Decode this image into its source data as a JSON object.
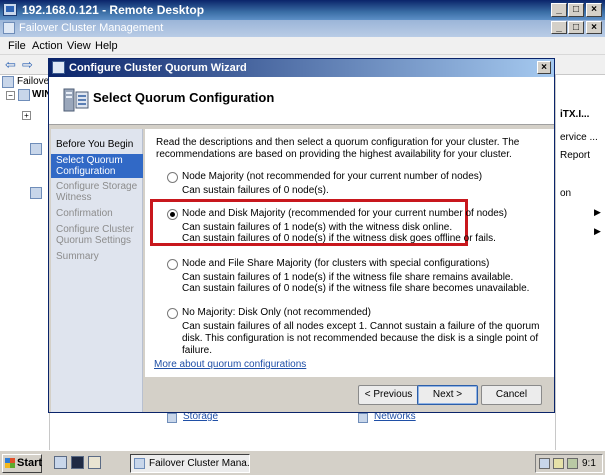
{
  "rdp": {
    "title": "192.168.0.121 - Remote Desktop"
  },
  "server": {
    "title": "Failover Cluster Management",
    "menu": [
      "File",
      "Action",
      "View",
      "Help"
    ],
    "tree": [
      "Failover",
      "WIN"
    ],
    "actions": [
      "iTX.I...",
      "ervice ...",
      "Report",
      "on"
    ],
    "bottom_links": [
      "Storage",
      "Networks"
    ]
  },
  "wizard": {
    "title": "Configure Cluster Quorum Wizard",
    "header_title": "Select Quorum Configuration",
    "close_label": "×",
    "nav": [
      {
        "label": "Before You Begin",
        "state": "done"
      },
      {
        "label": "Select Quorum Configuration",
        "state": "active"
      },
      {
        "label": "Configure Storage Witness",
        "state": "pending"
      },
      {
        "label": "Confirmation",
        "state": "pending"
      },
      {
        "label": "Configure Cluster Quorum Settings",
        "state": "pending"
      },
      {
        "label": "Summary",
        "state": "pending"
      }
    ],
    "intro": "Read the descriptions and then select a quorum configuration for your cluster. The recommendations are based on providing the highest availability for your cluster.",
    "options": [
      {
        "label": "Node Majority (not recommended for your current number of nodes)",
        "checked": false,
        "desc": [
          "Can sustain failures of 0 node(s)."
        ]
      },
      {
        "label": "Node and Disk Majority (recommended for your current number of nodes)",
        "checked": true,
        "desc": [
          "Can sustain failures of 1 node(s) with the witness disk online.",
          "Can sustain failures of 0 node(s) if the witness disk goes offline or fails."
        ]
      },
      {
        "label": "Node and File Share Majority (for clusters with special configurations)",
        "checked": false,
        "desc": [
          "Can sustain failures of 1 node(s) if the witness file share remains available.",
          "Can sustain failures of 0 node(s) if the witness file share becomes unavailable."
        ]
      },
      {
        "label": "No Majority: Disk Only (not recommended)",
        "checked": false,
        "desc": [
          "Can sustain failures of all nodes except 1. Cannot sustain a failure of the quorum disk. This configuration is not recommended because the disk is a single point of failure."
        ]
      }
    ],
    "more_link": "More about quorum configurations",
    "buttons": {
      "previous": "< Previous",
      "next": "Next >",
      "cancel": "Cancel"
    }
  },
  "taskbar": {
    "start": "Start",
    "task": "Failover Cluster Mana...",
    "clock": "9:1"
  },
  "colors": {
    "highlight_box": "#c8171d",
    "nav_active": "#3169c6",
    "link": "#1f4fa6"
  }
}
